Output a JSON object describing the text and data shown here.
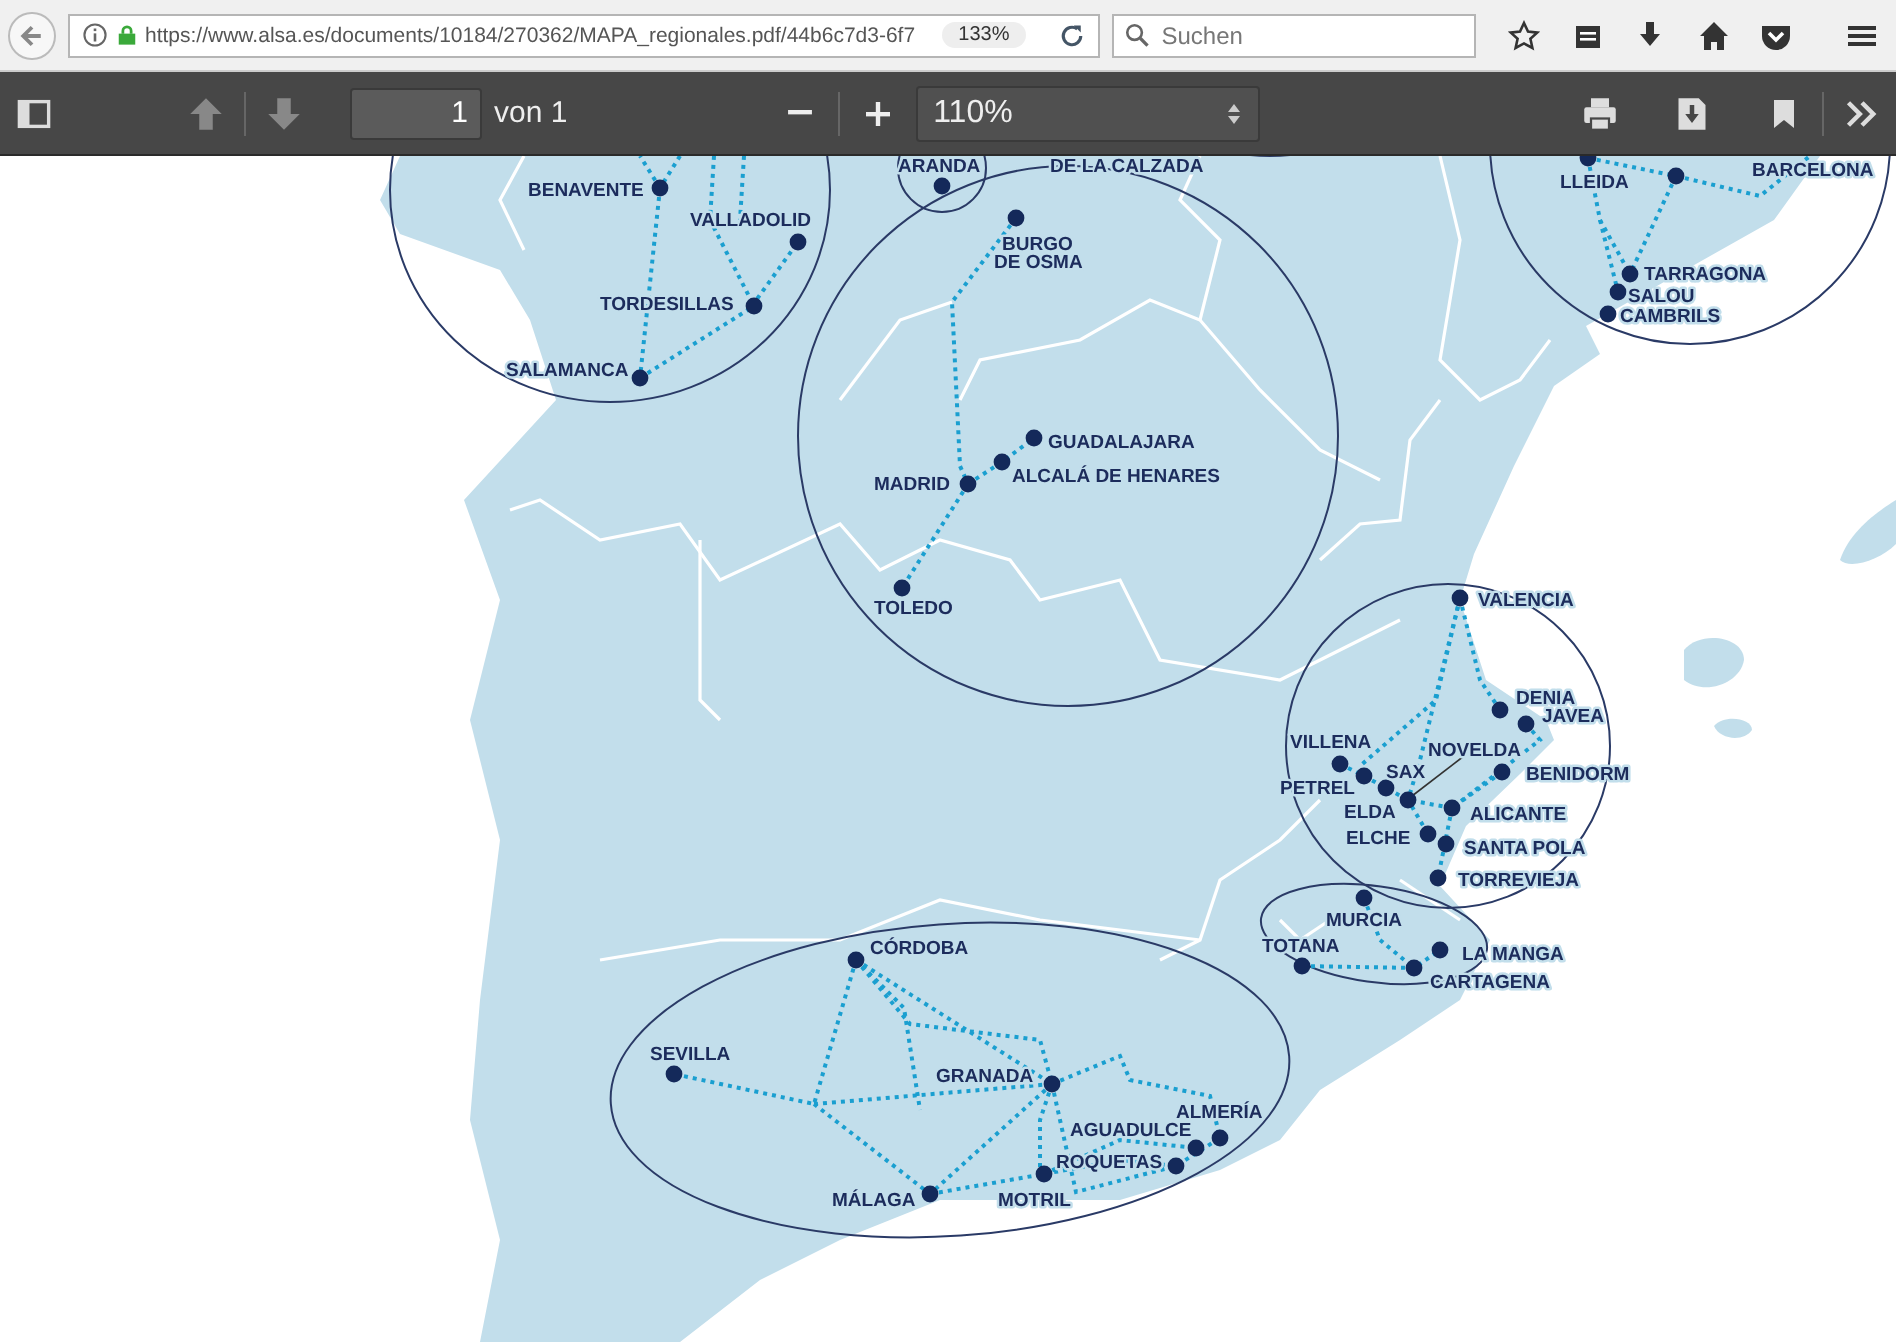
{
  "browser": {
    "url": "https://www.alsa.es/documents/10184/270362/MAPA_regionales.pdf/44b6c7d3-6f7",
    "zoom": "133%",
    "search": {
      "placeholder": "Suchen"
    }
  },
  "pdf_toolbar": {
    "page": "1",
    "page_count": "von 1",
    "zoom": "110%"
  },
  "map": {
    "cities": [
      {
        "name": "BENAVENTE",
        "kind": "stop"
      },
      {
        "name": "VALLADOLID",
        "kind": "stop"
      },
      {
        "name": "TORDESILLAS",
        "kind": "stop"
      },
      {
        "name": "SALAMANCA",
        "kind": "stop"
      },
      {
        "name": "ARANDA",
        "kind": "stop"
      },
      {
        "name": "DE LA CALZADA",
        "kind": "label"
      },
      {
        "name": "BURGO DE OSMA",
        "kind": "stop"
      },
      {
        "name": "GUADALAJARA",
        "kind": "stop"
      },
      {
        "name": "ALCALÁ DE HENARES",
        "kind": "stop"
      },
      {
        "name": "MADRID",
        "kind": "stop"
      },
      {
        "name": "TOLEDO",
        "kind": "stop"
      },
      {
        "name": "LLEIDA",
        "kind": "stop"
      },
      {
        "name": "BARCELONA",
        "kind": "label"
      },
      {
        "name": "TARRAGONA",
        "kind": "stop"
      },
      {
        "name": "SALOU",
        "kind": "stop"
      },
      {
        "name": "CAMBRILS",
        "kind": "stop"
      },
      {
        "name": "VALENCIA",
        "kind": "stop"
      },
      {
        "name": "DENIA",
        "kind": "stop"
      },
      {
        "name": "JAVEA",
        "kind": "stop"
      },
      {
        "name": "NOVELDA",
        "kind": "stop"
      },
      {
        "name": "VILLENA",
        "kind": "stop"
      },
      {
        "name": "SAX",
        "kind": "stop"
      },
      {
        "name": "PETREL",
        "kind": "stop"
      },
      {
        "name": "BENIDORM",
        "kind": "stop"
      },
      {
        "name": "ELDA",
        "kind": "label"
      },
      {
        "name": "ALICANTE",
        "kind": "stop"
      },
      {
        "name": "ELCHE",
        "kind": "stop"
      },
      {
        "name": "SANTA POLA",
        "kind": "stop"
      },
      {
        "name": "TORREVIEJA",
        "kind": "stop"
      },
      {
        "name": "MURCIA",
        "kind": "stop"
      },
      {
        "name": "TOTANA",
        "kind": "stop"
      },
      {
        "name": "LA MANGA",
        "kind": "stop"
      },
      {
        "name": "CARTAGENA",
        "kind": "stop"
      },
      {
        "name": "CÓRDOBA",
        "kind": "stop"
      },
      {
        "name": "SEVILLA",
        "kind": "stop"
      },
      {
        "name": "GRANADA",
        "kind": "stop"
      },
      {
        "name": "ALMERÍA",
        "kind": "stop"
      },
      {
        "name": "AGUADULCE",
        "kind": "stop"
      },
      {
        "name": "ROQUETAS",
        "kind": "stop"
      },
      {
        "name": "MOTRIL",
        "kind": "stop"
      },
      {
        "name": "MÁLAGA",
        "kind": "stop"
      }
    ]
  }
}
